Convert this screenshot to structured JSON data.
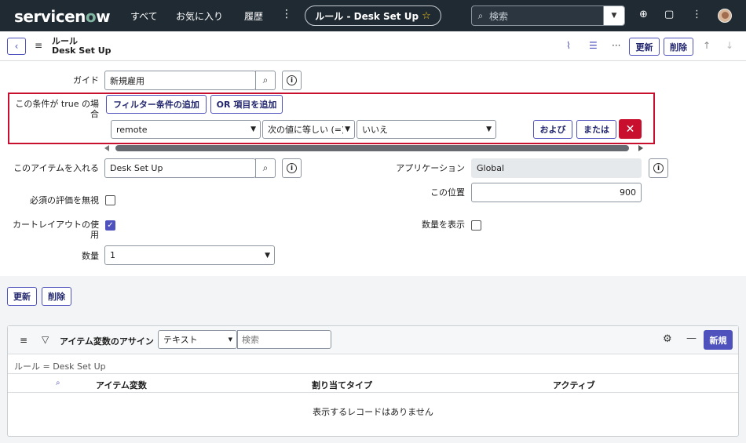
{
  "nav": {
    "logo_pre": "servicen",
    "logo_o": "o",
    "logo_post": "w",
    "all": "すべて",
    "favorites": "お気に入り",
    "history": "履歴",
    "context_title": "ルール - Desk Set Up",
    "search_placeholder": "検索"
  },
  "header": {
    "title_line1": "ルール",
    "title_line2": "Desk Set Up",
    "update": "更新",
    "delete": "削除"
  },
  "form": {
    "guide_label": "ガイド",
    "guide_value": "新規雇用",
    "condition_label": "この条件が true の場合",
    "add_filter": "フィルター条件の追加",
    "add_or": "OR 項目を追加",
    "cond_field": "remote",
    "cond_operator": "次の値に等しい (=)",
    "cond_value": "いいえ",
    "and": "および",
    "or": "または",
    "put_item_label": "このアイテムを入れる",
    "put_item_value": "Desk Set Up",
    "application_label": "アプリケーション",
    "application_value": "Global",
    "position_label": "この位置",
    "position_value": "900",
    "ignore_mandatory_label": "必須の評価を無視",
    "use_cart_layout_label": "カートレイアウトの使用",
    "show_quantity_label": "数量を表示",
    "quantity_label": "数量",
    "quantity_value": "1"
  },
  "bottom": {
    "update": "更新",
    "delete": "削除"
  },
  "related": {
    "title": "アイテム変数のアサイン",
    "search_field": "テキスト",
    "search_placeholder": "検索",
    "new": "新規",
    "breadcrumb": "ルール = Desk Set Up",
    "columns": [
      "アイテム変数",
      "割り当てタイプ",
      "アクティブ"
    ],
    "empty": "表示するレコードはありません"
  },
  "colors": {
    "accent": "#4f52bd",
    "nav_bg": "#202a33",
    "danger": "#c8102e"
  }
}
